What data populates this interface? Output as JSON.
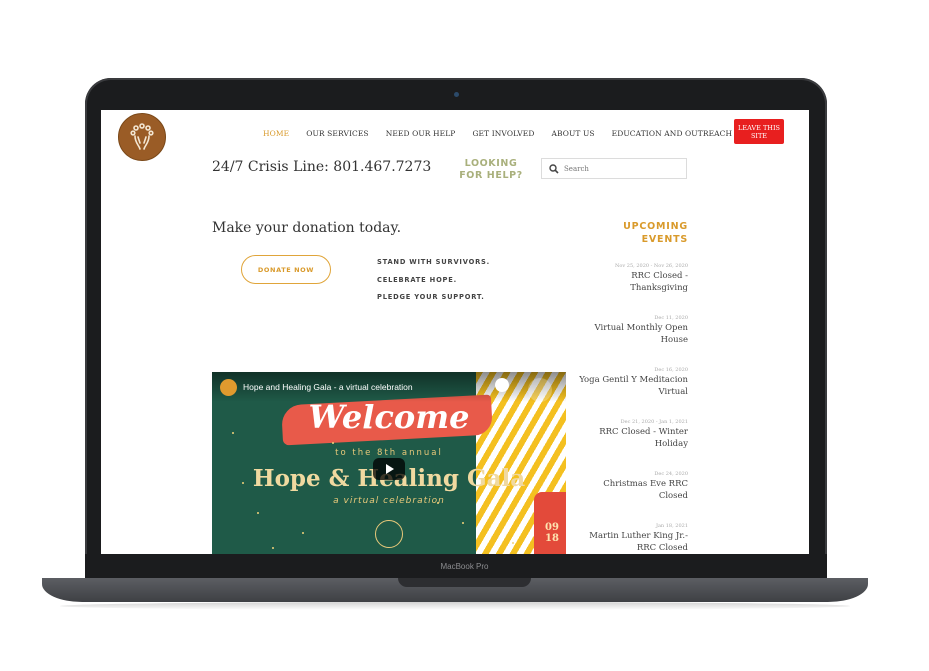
{
  "device": {
    "label": "MacBook Pro"
  },
  "site": {
    "nav": [
      {
        "label": "HOME",
        "active": true
      },
      {
        "label": "OUR SERVICES",
        "active": false
      },
      {
        "label": "NEED OUR HELP",
        "active": false
      },
      {
        "label": "GET INVOLVED",
        "active": false
      },
      {
        "label": "ABOUT US",
        "active": false
      },
      {
        "label": "EDUCATION AND OUTREACH",
        "active": false
      }
    ],
    "leave_button": "LEAVE THIS SITE",
    "crisis_line": "24/7 Crisis Line: 801.467.7273",
    "looking_for_help": "LOOKING FOR HELP?",
    "search_placeholder": "Search",
    "donation_title": "Make your donation today.",
    "donate_button": "DONATE NOW",
    "pledge": [
      "STAND WITH SURVIVORS.",
      "CELEBRATE HOPE.",
      "PLEDGE YOUR SUPPORT."
    ],
    "upcoming_events_title": "UPCOMING EVENTS",
    "events": [
      {
        "date": "Nov 25, 2020 - Nov 26, 2020",
        "name": "RRC Closed - Thanksgiving"
      },
      {
        "date": "Dec 11, 2020",
        "name": "Virtual Monthly Open House"
      },
      {
        "date": "Dec 16, 2020",
        "name": "Yoga Gentil Y Meditacion Virtual"
      },
      {
        "date": "Dec 21, 2020 - Jan 1, 2021",
        "name": "RRC Closed - Winter Holiday"
      },
      {
        "date": "Dec 24, 2020",
        "name": "Christmas Eve RRC Closed"
      },
      {
        "date": "Jan 18, 2021",
        "name": "Martin Luther King Jr.- RRC Closed"
      }
    ],
    "video": {
      "title": "Hope and Healing Gala - a virtual celebration",
      "welcome": "Welcome",
      "annual": "to the 8th annual",
      "gala": "Hope & Healing Gala",
      "virtual": "a virtual celebration",
      "date": "09 18"
    }
  },
  "colors": {
    "accent": "#d99a2b",
    "leave": "#e81f1f",
    "looking": "#a9b07c",
    "video_bg": "#1f5a48"
  }
}
